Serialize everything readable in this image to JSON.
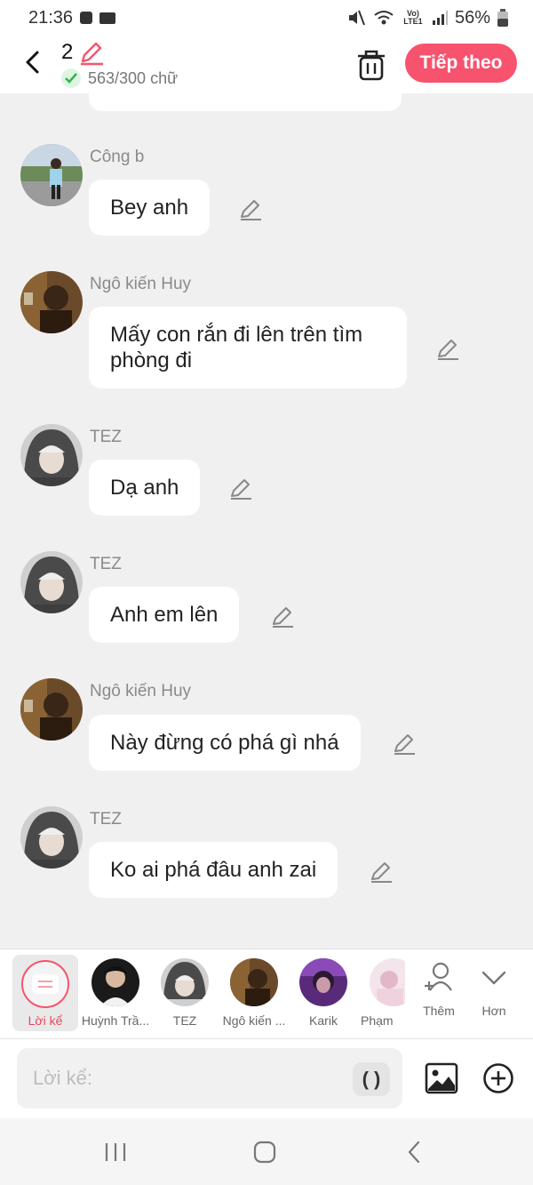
{
  "status_bar": {
    "time": "21:36",
    "battery": "56%",
    "network": "Vo) LTE1"
  },
  "header": {
    "title": "2",
    "word_count": "563/300 chữ",
    "next_label": "Tiếp theo",
    "accent_color": "#f7536e"
  },
  "messages": [
    {
      "name": "Công b",
      "text": "Bey anh",
      "avatar": "photo-outdoor"
    },
    {
      "name": "Ngô kiến Huy",
      "text": "Mấy con rắn đi lên trên tìm phòng đi",
      "avatar": "photo-huy"
    },
    {
      "name": "TEZ",
      "text": "Dạ anh",
      "avatar": "photo-tez"
    },
    {
      "name": "TEZ",
      "text": "Anh em lên",
      "avatar": "photo-tez"
    },
    {
      "name": "Ngô kiến Huy",
      "text": "Này đừng có phá gì nhá",
      "avatar": "photo-huy"
    },
    {
      "name": "TEZ",
      "text": "Ko ai phá đâu anh zai",
      "avatar": "photo-tez"
    }
  ],
  "characters": {
    "narrator_label": "Lời kể",
    "items": [
      {
        "label": "Huỳnh Trầ...",
        "avatar": "photo-dark"
      },
      {
        "label": "TEZ",
        "avatar": "photo-tez"
      },
      {
        "label": "Ngô kiến ...",
        "avatar": "photo-huy"
      },
      {
        "label": "Karik",
        "avatar": "photo-karik"
      },
      {
        "label": "Phạm",
        "avatar": "photo-pink"
      }
    ],
    "more_label": "Thêm",
    "expand_label": "Hơn"
  },
  "input": {
    "placeholder": "Lời kể:",
    "paren_label": "( )"
  }
}
